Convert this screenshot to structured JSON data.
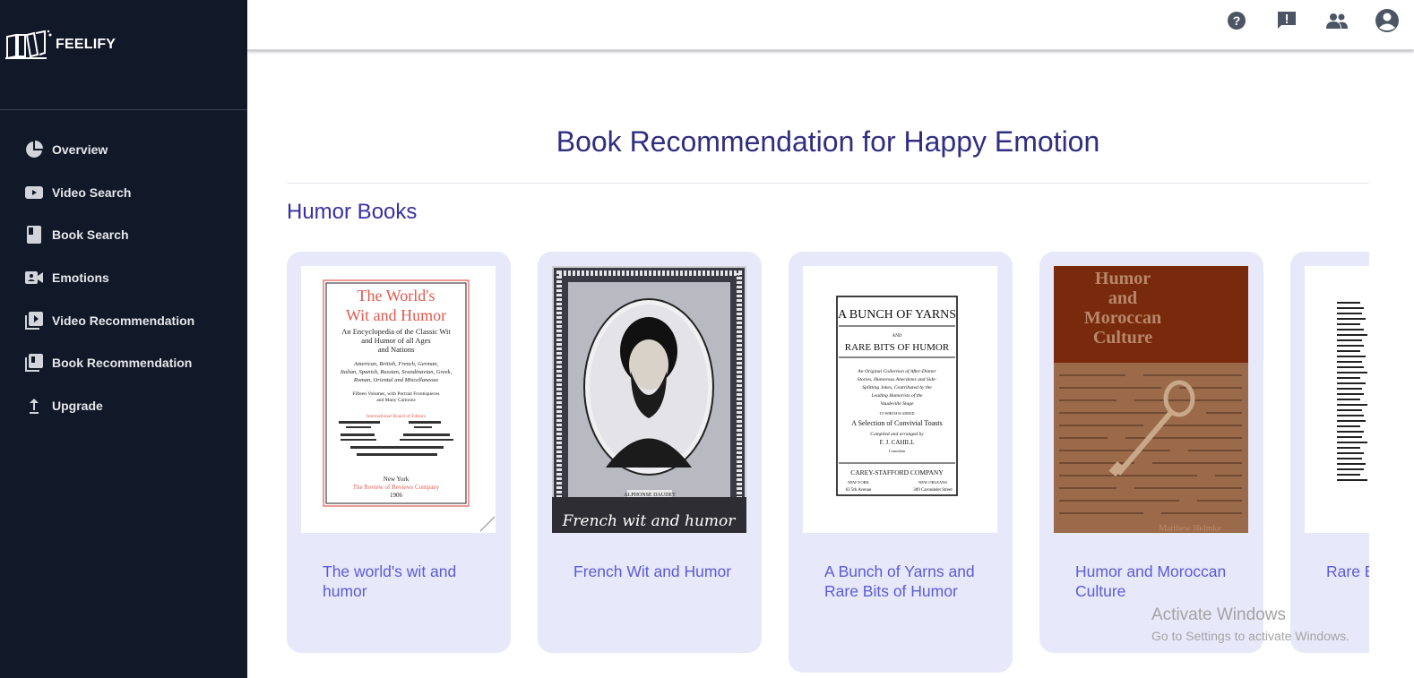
{
  "brand": {
    "name": "FEELIFY"
  },
  "sidebar": {
    "items": [
      {
        "label": "Overview",
        "icon": "pie-chart-icon"
      },
      {
        "label": "Video Search",
        "icon": "youtube-icon"
      },
      {
        "label": "Book Search",
        "icon": "book-icon"
      },
      {
        "label": "Emotions",
        "icon": "video-camera-icon"
      },
      {
        "label": "Video Recommendation",
        "icon": "video-library-icon"
      },
      {
        "label": "Book Recommendation",
        "icon": "library-books-icon"
      },
      {
        "label": "Upgrade",
        "icon": "upload-icon"
      }
    ]
  },
  "topbar": {
    "icons": [
      "help-icon",
      "feedback-icon",
      "people-icon",
      "account-icon"
    ]
  },
  "main": {
    "title": "Book Recommendation for Happy Emotion",
    "section_title": "Humor Books"
  },
  "books": [
    {
      "title": "The world's wit and humor",
      "cover": {
        "t1": "The World's",
        "t2": "Wit and Humor",
        "l1": "An Encyclopedia of the Classic Wit",
        "l2": "and Humor of all Ages",
        "l3": "and Nations",
        "l4": "American, British, French, German,",
        "l5": "Italian, Spanish, Russian, Scandinavian, Greek,",
        "l6": "Roman, Oriental and Miscellaneous",
        "l7": "Fifteen Volumes, with Portrait Frontispieces",
        "l8": "and Many Cartoons",
        "l9": "International Board of Editors",
        "p1": "New York",
        "p2": "The Review of Reviews Company",
        "p3": "1906"
      }
    },
    {
      "title": "French Wit and Humor",
      "cover": {
        "caption": "French wit and humor",
        "plate": "ALPHONSE DAUDET"
      }
    },
    {
      "title": "A Bunch of Yarns and Rare Bits of Humor",
      "cover": {
        "h1": "A BUNCH OF YARNS",
        "h2": "AND",
        "h3": "RARE BITS OF HUMOR",
        "d1": "An Original Collection of After-Dinner",
        "d2": "Stories, Humorous Anecdotes and Side-",
        "d3": "Splitting Jokes, Contributed by the",
        "d4": "Leading Humorists of the",
        "d5": "Vaudeville Stage",
        "d6": "TO WHICH IS ADDED",
        "d7": "A Selection of Convivial Toasts",
        "d8": "Compiled and arranged by",
        "d9": "F. J. CAHILL",
        "d10": "Comedian",
        "pub": "CAREY-STAFFORD COMPANY",
        "c1": "NEW YORK",
        "c2": "NEW ORLEANS",
        "a1": "63 5th Avenue",
        "a2": "309 Carondelet Street"
      }
    },
    {
      "title": "Humor and Moroccan Culture",
      "cover": {
        "t1": "Humor",
        "t2": "and",
        "t3": "Moroccan",
        "t4": "Culture",
        "author": "Matthew Helmke"
      }
    },
    {
      "title": "Rare B"
    }
  ],
  "watermark": {
    "line1": "Activate Windows",
    "line2": "Go to Settings to activate Windows."
  },
  "colors": {
    "sidebar": "#111827",
    "title": "#312e81",
    "card": "#e8e8fb",
    "card_title": "#5b5bd6"
  }
}
